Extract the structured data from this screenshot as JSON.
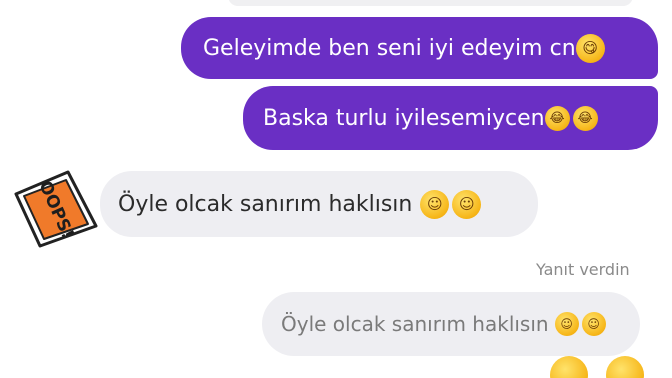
{
  "messages": [
    {
      "id": "m1",
      "direction": "outgoing",
      "text": "Geleyimde ben seni iyi edeyim cn",
      "emojis": [
        "tongue-out-icon"
      ]
    },
    {
      "id": "m2",
      "direction": "outgoing",
      "text": "Baska turlu iyilesemiycen",
      "emojis": [
        "tears-of-joy-icon",
        "tears-of-joy-icon"
      ]
    },
    {
      "id": "m3",
      "direction": "incoming",
      "text": "Öyle olcak sanırım haklısın",
      "emojis": [
        "smiling-face-icon",
        "smiling-face-icon"
      ]
    }
  ],
  "reply": {
    "label": "Yanıt verdin",
    "quoted_text": "Öyle olcak sanırım haklısın",
    "quoted_emojis": [
      "smiling-face-icon",
      "smiling-face-icon"
    ]
  },
  "sticker": {
    "name": "oops-sticker-icon",
    "text": "OOPS!"
  },
  "colors": {
    "outgoing_bubble": "#6a2fc4",
    "incoming_bubble": "#eeeef2",
    "sticker_orange": "#f07a2a"
  }
}
